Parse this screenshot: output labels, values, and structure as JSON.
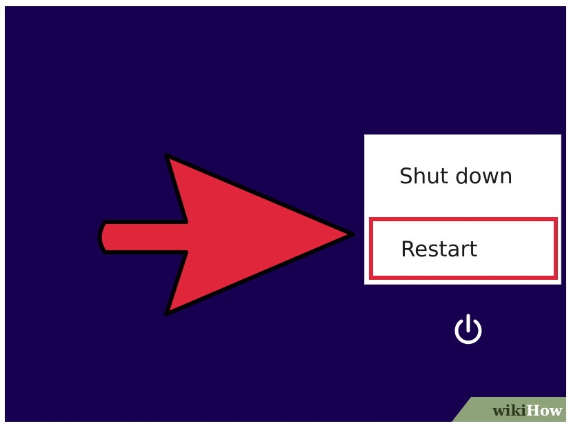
{
  "power_menu": {
    "items": [
      {
        "label": "Shut down"
      },
      {
        "label": "Restart",
        "highlighted": true
      }
    ],
    "highlight_color": "#e0263a"
  },
  "power_button": {
    "icon": "power-icon"
  },
  "annotation": {
    "icon": "arrow-right-icon",
    "color": "#e0263a"
  },
  "watermark": {
    "part1": "wiki",
    "part2": "How"
  },
  "colors": {
    "background": "#16004f",
    "menu_background": "#ffffff"
  }
}
